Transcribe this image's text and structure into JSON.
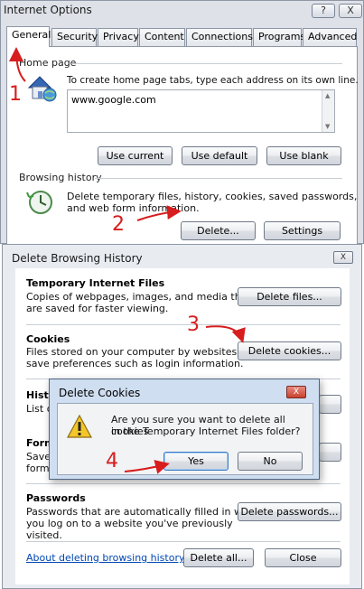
{
  "internet_options": {
    "title": "Internet Options",
    "help_label": "?",
    "close_label": "X",
    "tabs": [
      "General",
      "Security",
      "Privacy",
      "Content",
      "Connections",
      "Programs",
      "Advanced"
    ],
    "home_page": {
      "group_label": "Home page",
      "description": "To create home page tabs, type each address on its own line.",
      "url": "www.google.com",
      "buttons": [
        "Use current",
        "Use default",
        "Use blank"
      ]
    },
    "browsing_history": {
      "group_label": "Browsing history",
      "description_line1": "Delete temporary files, history, cookies, saved passwords,",
      "description_line2": "and web form information.",
      "delete_button": "Delete...",
      "settings_button": "Settings"
    }
  },
  "delete_browsing_history": {
    "title": "Delete Browsing History",
    "close_label": "X",
    "sections": [
      {
        "heading": "Temporary Internet Files",
        "line1": "Copies of webpages, images, and media that",
        "line2": "are saved for faster viewing.",
        "line3": "",
        "button": "Delete files..."
      },
      {
        "heading": "Cookies",
        "line1": "Files stored on your computer by websites to",
        "line2": "save preferences such as login information.",
        "line3": "",
        "button": "Delete cookies..."
      },
      {
        "heading": "Histo",
        "line1": "List o",
        "line2": "",
        "line3": "",
        "button": ""
      },
      {
        "heading": "Form",
        "line1": "Save",
        "line2": "forms",
        "line3": "",
        "button": ""
      },
      {
        "heading": "Passwords",
        "line1": "Passwords that are automatically filled in when",
        "line2": "you log on to a website you've previously",
        "line3": "visited.",
        "button": "Delete passwords..."
      }
    ],
    "about_link": "About deleting browsing history",
    "delete_all_button": "Delete all...",
    "close_button": "Close"
  },
  "delete_cookies": {
    "title": "Delete Cookies",
    "close_label": "X",
    "message_line1": "Are you sure you want to delete all cookies",
    "message_line2": "in the Temporary Internet Files folder?",
    "yes_button": "Yes",
    "no_button": "No"
  },
  "annotations": {
    "step1": "1",
    "step2": "2",
    "step3": "3",
    "step4": "4",
    "color": "#d71d1d"
  },
  "icons": [
    "home-page-icon",
    "history-clock-icon",
    "warning-icon"
  ]
}
